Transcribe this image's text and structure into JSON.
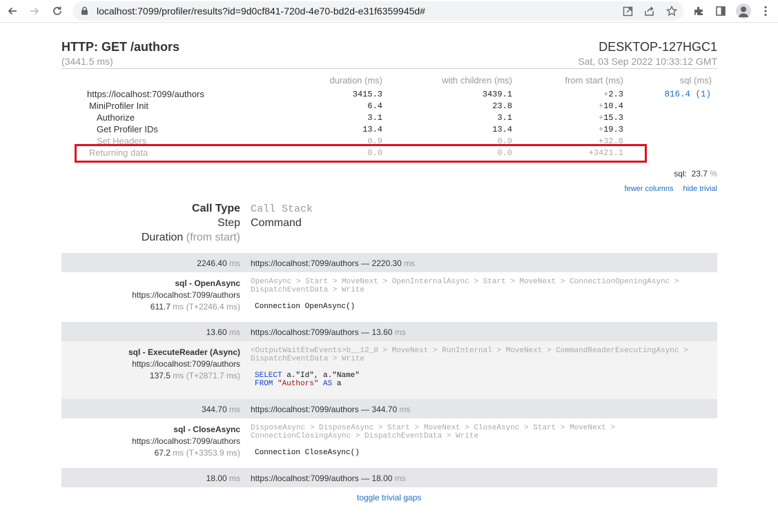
{
  "browser": {
    "url": "localhost:7099/profiler/results?id=9d0cf841-720d-4e70-bd2d-e31f6359945d#"
  },
  "header": {
    "title": "HTTP: GET /authors",
    "duration": "(3441.5 ms)",
    "server": "DESKTOP-127HGC1",
    "date": "Sat, 03 Sep 2022 10:33:12 GMT"
  },
  "timings": {
    "columns": [
      "duration (ms)",
      "with children (ms)",
      "from start (ms)",
      "sql (ms)"
    ],
    "rows": [
      {
        "name": "https://localhost:7099/authors",
        "duration": "3415.3",
        "children": "3439.1",
        "start_sign": "+",
        "start": "2.3",
        "sql": "816.4 (1)"
      },
      {
        "name": "MiniProfiler Init",
        "duration": "6.4",
        "children": "23.8",
        "start_sign": "+",
        "start": "10.4"
      },
      {
        "name": "Authorize",
        "duration": "3.1",
        "children": "3.1",
        "start_sign": "+",
        "start": "15.3"
      },
      {
        "name": "Get Profiler IDs",
        "duration": "13.4",
        "children": "13.4",
        "start_sign": "+",
        "start": "19.3"
      },
      {
        "name": "Set Headers",
        "duration": "0.9",
        "children": "0.9",
        "start_sign": "+",
        "start": "32.8"
      },
      {
        "name": "Returning data",
        "duration": "0.0",
        "children": "0.0",
        "start_sign": "+",
        "start": "3421.1"
      }
    ],
    "sql_label": "sql:",
    "sql_percent": "23.7",
    "sql_percent_unit": "%",
    "fewer_columns": "fewer columns",
    "hide_trivial": "hide trivial"
  },
  "queries": {
    "legend": {
      "call_type": "Call Type",
      "call_stack": "Call Stack",
      "step": "Step",
      "command": "Command",
      "duration": "Duration",
      "from_start": "(from start)"
    },
    "gaps": [
      {
        "duration": "2246.40",
        "ms": "ms",
        "url": "https://localhost:7099/authors —",
        "value": "2220.30"
      },
      {
        "duration": "13.60",
        "ms": "ms",
        "url": "https://localhost:7099/authors —",
        "value": "13.60"
      },
      {
        "duration": "344.70",
        "ms": "ms",
        "url": "https://localhost:7099/authors —",
        "value": "344.70"
      },
      {
        "duration": "18.00",
        "ms": "ms",
        "url": "https://localhost:7099/authors —",
        "value": "18.00"
      }
    ],
    "items": [
      {
        "type": "sql - OpenAsync",
        "step": "https://localhost:7099/authors",
        "duration": "611.7",
        "ms": "ms",
        "from_start": "(T+2246.4 ms)",
        "stack_line1": "OpenAsync > Start > MoveNext > OpenInternalAsync > Start > MoveNext > ConnectionOpeningAsync >",
        "stack_line2": "DispatchEventData > Write",
        "command": "Connection OpenAsync()"
      },
      {
        "type": "sql - ExecuteReader (Async)",
        "step": "https://localhost:7099/authors",
        "duration": "137.5",
        "ms": "ms",
        "from_start": "(T+2871.7 ms)",
        "stack_line1": "<OutputWaitEtwEvents>b__12_0 > MoveNext > RunInternal > MoveNext > CommandReaderExecutingAsync >",
        "stack_line2": "DispatchEventData > Write",
        "command_select": "SELECT",
        "command_cols": " a.\"Id\", a.\"Name\"",
        "command_from": "FROM",
        "command_table": " \"Authors\"",
        "command_as": " AS",
        "command_alias": " a"
      },
      {
        "type": "sql - CloseAsync",
        "step": "https://localhost:7099/authors",
        "duration": "67.2",
        "ms": "ms",
        "from_start": "(T+3353.9 ms)",
        "stack_line1": "DisposeAsync > DisposeAsync > Start > MoveNext > CloseAsync > Start > MoveNext >",
        "stack_line2": "ConnectionClosingAsync > DispatchEventData > Write",
        "command": "Connection CloseAsync()"
      }
    ],
    "toggle_gaps": "toggle trivial gaps"
  }
}
